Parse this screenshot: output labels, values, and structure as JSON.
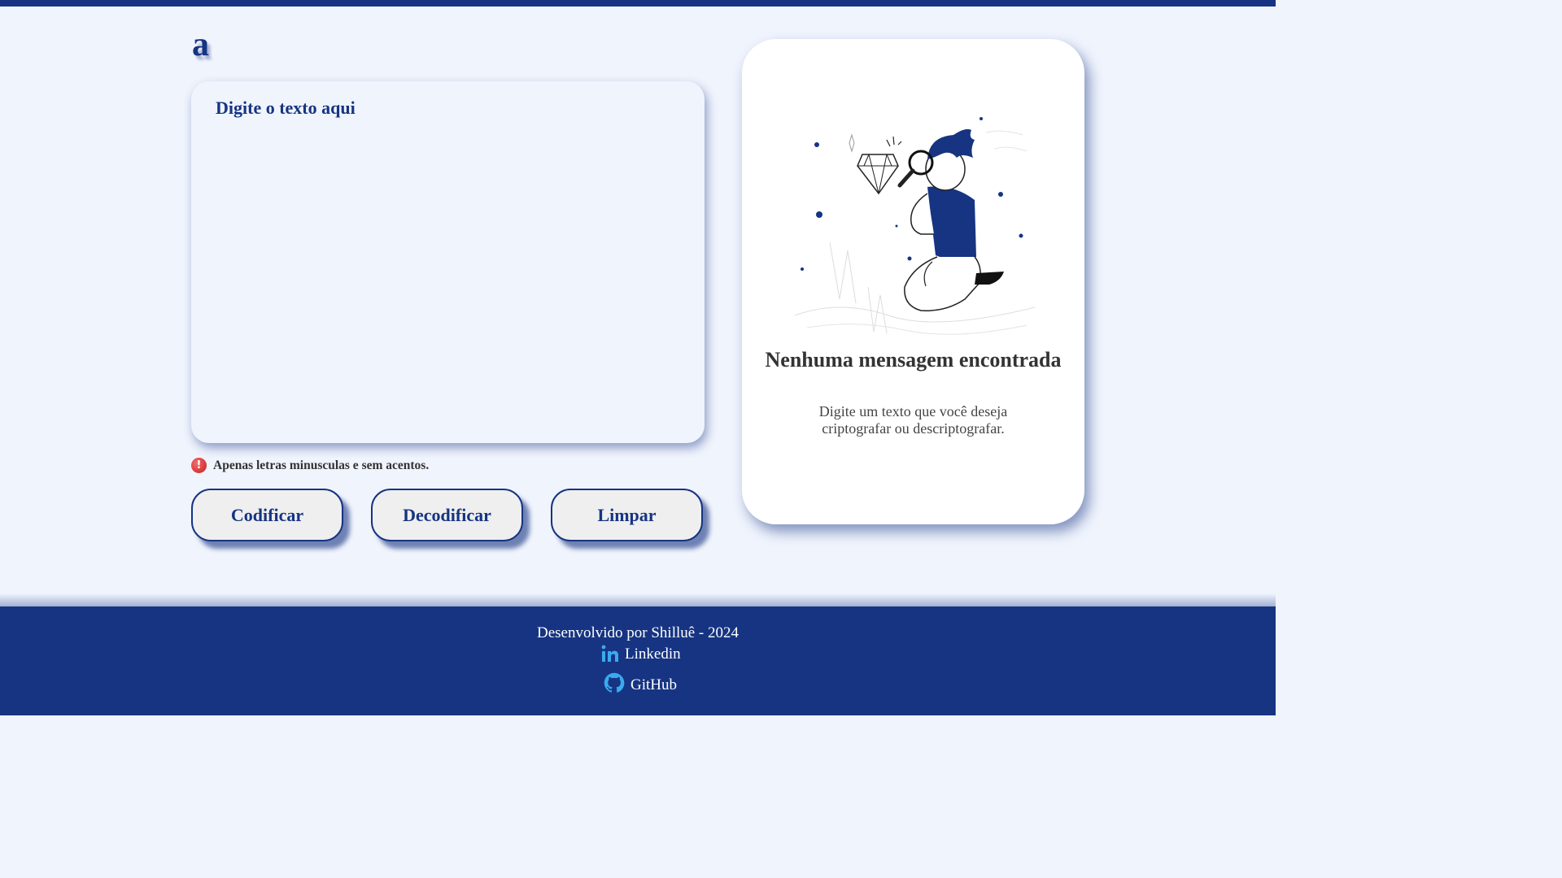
{
  "header": {
    "logo_text": "a"
  },
  "input": {
    "placeholder": "Digite o texto aqui",
    "value": ""
  },
  "warning": {
    "icon": "exclamation-icon",
    "text": "Apenas letras minusculas e sem acentos."
  },
  "buttons": {
    "encode": "Codificar",
    "decode": "Decodificar",
    "clear": "Limpar"
  },
  "result": {
    "illustration": "person-with-magnifier-illustration",
    "title": "Nenhuma mensagem encontrada",
    "subtitle": "Digite um texto que você deseja criptografar ou descriptografar."
  },
  "footer": {
    "text": "Desenvolvido por Shilluê - 2024",
    "links": [
      {
        "icon": "linkedin-icon",
        "label": "Linkedin"
      },
      {
        "icon": "github-icon",
        "label": "GitHub"
      }
    ]
  },
  "colors": {
    "primary": "#163482",
    "background": "#f0f4fd",
    "card": "#ffffff",
    "accent": "#0a66c2"
  }
}
